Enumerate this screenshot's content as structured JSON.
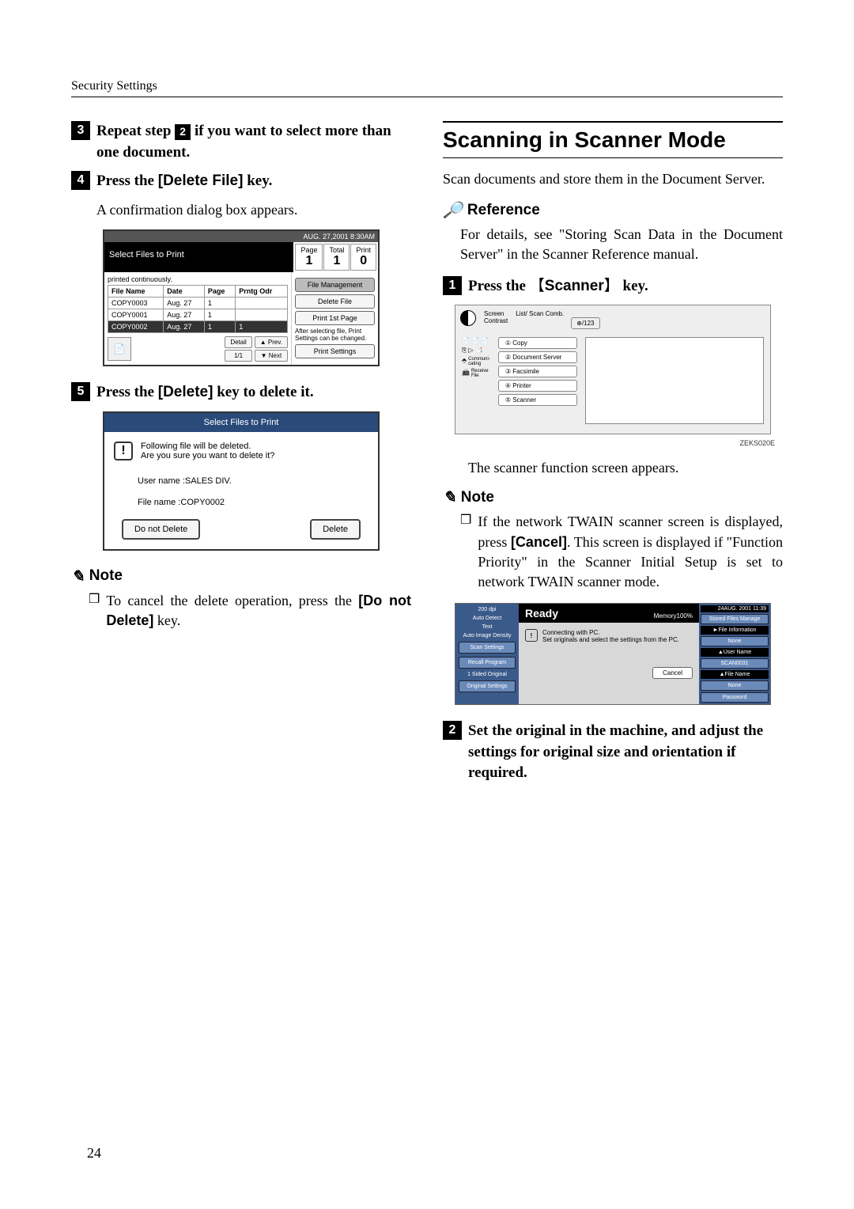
{
  "header": "Security Settings",
  "pageNumber": "24",
  "left": {
    "step3": {
      "num": "3",
      "pre": "Repeat step ",
      "inline": "2",
      "post": " if you want to select more than one document."
    },
    "step4": {
      "num": "4",
      "pre": "Press the ",
      "key": "[Delete File]",
      "post": " key."
    },
    "step4_sub": "A confirmation dialog box appears.",
    "step5": {
      "num": "5",
      "pre": "Press the ",
      "key": "[Delete]",
      "post": " key to delete it."
    },
    "noteLabel": "Note",
    "noteBody": {
      "pre": "To cancel the delete operation, press the ",
      "key": "[Do not Delete]",
      "post": " key."
    }
  },
  "right": {
    "title": "Scanning in Scanner Mode",
    "intro": "Scan documents and store them in the Document Server.",
    "refLabel": "Reference",
    "refBody": "For details, see \"Storing Scan Data in the Document Server\" in the Scanner Reference manual.",
    "step1": {
      "num": "1",
      "pre": "Press the ",
      "keyL": "【",
      "key": "Scanner",
      "keyR": "】",
      "post": " key."
    },
    "step1_sub": "The scanner function screen appears.",
    "noteLabel": "Note",
    "noteBody": {
      "pre": "If the network TWAIN scanner screen is displayed, press ",
      "key": "[Cancel]",
      "post": ". This screen is displayed if \"Function Priority\" in the Scanner Initial Setup is set to network TWAIN scanner mode."
    },
    "step2": {
      "num": "2",
      "text": "Set the original in the machine, and adjust the settings for original size and orientation if required."
    }
  },
  "ss1": {
    "date": "AUG.  27,2001  8:30AM",
    "title": "Select Files to Print",
    "page": "Page",
    "pageV": "1",
    "total": "Total",
    "totalV": "1",
    "print": "Print",
    "printV": "0",
    "sub": "printed continuously.",
    "cols": {
      "file": "File Name",
      "date": "Date",
      "page": "Page",
      "ord": "Prntg Odr"
    },
    "rows": [
      {
        "file": "COPY0003",
        "date": "Aug.  27",
        "page": "1",
        "ord": ""
      },
      {
        "file": "COPY0001",
        "date": "Aug.  27",
        "page": "1",
        "ord": ""
      },
      {
        "file": "COPY0002",
        "date": "Aug.  27",
        "page": "1",
        "ord": "1"
      }
    ],
    "detail": "Detail",
    "frac": "1/1",
    "prev": "▲ Prev.",
    "next": "▼ Next",
    "fileMgmt": "File Management",
    "deleteFile": "Delete File",
    "print1st": "Print 1st Page",
    "afterSel": "After selecting file, Print Settings can be changed.",
    "printSettings": "Print Settings"
  },
  "ss2": {
    "title": "Select Files to Print",
    "msg1": "Following file will be  deleted.",
    "msg2": "Are you sure you want to delete it?",
    "info1": "User name :SALES  DIV.",
    "info2": "File name :COPY0002",
    "btn1": "Do not Delete",
    "btn2": "Delete"
  },
  "ss3": {
    "sc1": "Screen",
    "sc2": "Contrast",
    "store1": "List/ Scan Comb.",
    "store2": "⊕/123",
    "funcs": [
      "① Copy",
      "② Document Server",
      "③ Facsimile",
      "④ Printer",
      "⑤ Scanner"
    ],
    "label": "ZEKS020E"
  },
  "ss4": {
    "date": "24AUG.   2001  11:39",
    "left": [
      "200 dpi",
      "Auto Detect",
      "Text",
      "Auto Image Density",
      "Scan Settings",
      "Recall Program",
      "1 Sided Original",
      "Original Settings"
    ],
    "ready": "Ready",
    "memory": "Memory100%",
    "msg1": "Connecting with PC.",
    "msg2": "Set originals and select the settings from the PC.",
    "cancel": "Cancel",
    "right": [
      "Stored Files Manage",
      "►File Information",
      "None",
      "▲User Name",
      "SCAN0031",
      "▲File Name",
      "None",
      "Password"
    ]
  }
}
